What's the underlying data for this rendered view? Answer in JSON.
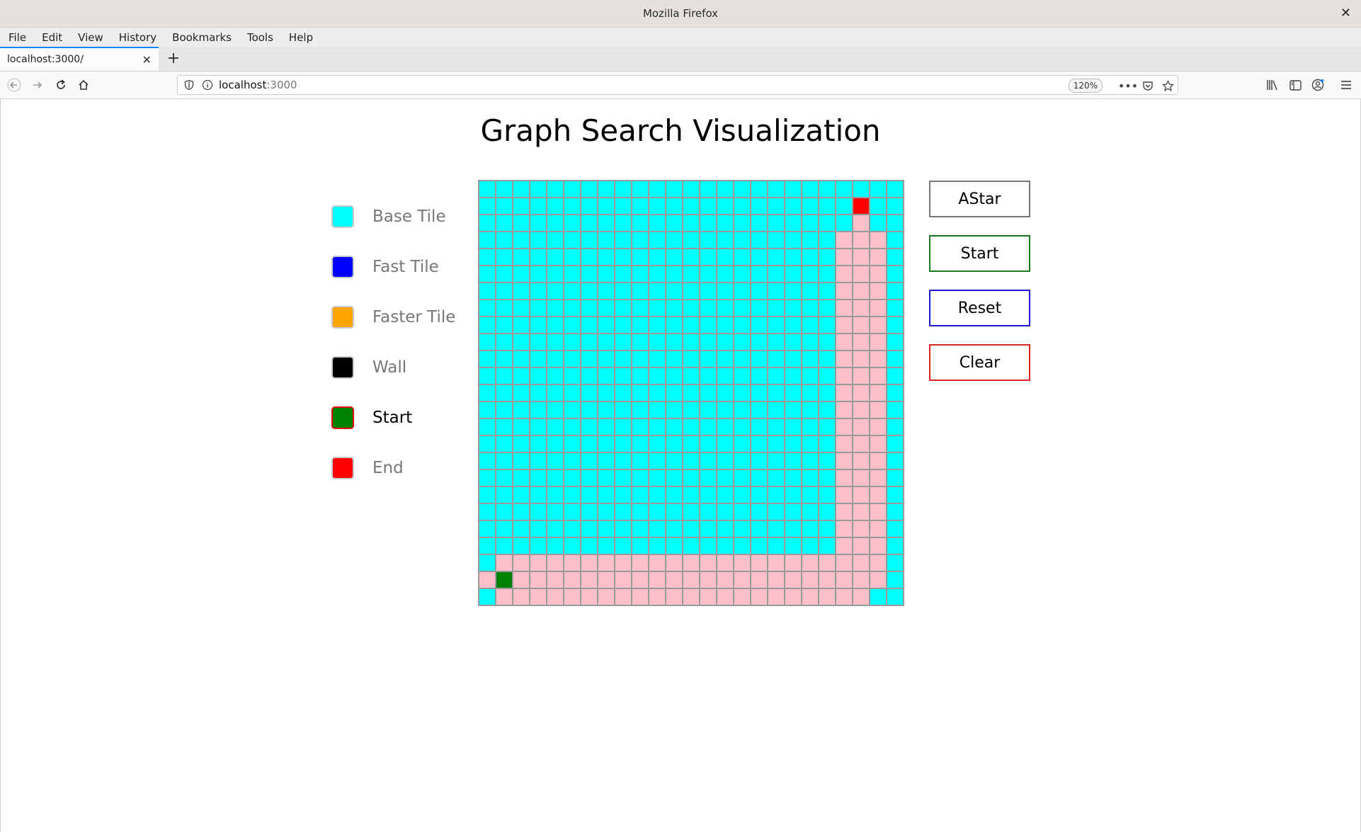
{
  "window": {
    "title": "Mozilla Firefox"
  },
  "menu": [
    "File",
    "Edit",
    "View",
    "History",
    "Bookmarks",
    "Tools",
    "Help"
  ],
  "tab": {
    "title": "localhost:3000/"
  },
  "url": {
    "host": "localhost",
    "port": ":3000",
    "zoom": "120%"
  },
  "page": {
    "title": "Graph Search Visualization"
  },
  "legend": [
    {
      "label": "Base Tile",
      "color": "#00ffff",
      "border": "#c9c9c9",
      "active": false
    },
    {
      "label": "Fast Tile",
      "color": "#0000ff",
      "border": "#c9c9c9",
      "active": false
    },
    {
      "label": "Faster Tile",
      "color": "#ffa500",
      "border": "#c9c9c9",
      "active": false
    },
    {
      "label": "Wall",
      "color": "#000000",
      "border": "#c9c9c9",
      "active": false
    },
    {
      "label": "Start",
      "color": "#008000",
      "border": "#e01010",
      "active": true
    },
    {
      "label": "End",
      "color": "#ff0000",
      "border": "#c9c9c9",
      "active": false
    }
  ],
  "buttons": {
    "astar": "AStar",
    "start": "Start",
    "reset": "Reset",
    "clear": "Clear"
  },
  "grid": {
    "rows": 25,
    "cols": 25,
    "colors": {
      "base": "#00ffff",
      "path": "#ffc0cb",
      "start": "#008000",
      "end": "#ff0000"
    },
    "start": [
      23,
      1
    ],
    "end": [
      1,
      22
    ],
    "path_cells": [
      [
        2,
        22
      ],
      [
        3,
        21
      ],
      [
        3,
        22
      ],
      [
        3,
        23
      ],
      [
        4,
        21
      ],
      [
        4,
        22
      ],
      [
        4,
        23
      ],
      [
        5,
        21
      ],
      [
        5,
        22
      ],
      [
        5,
        23
      ],
      [
        6,
        21
      ],
      [
        6,
        22
      ],
      [
        6,
        23
      ],
      [
        7,
        21
      ],
      [
        7,
        22
      ],
      [
        7,
        23
      ],
      [
        8,
        21
      ],
      [
        8,
        22
      ],
      [
        8,
        23
      ],
      [
        9,
        21
      ],
      [
        9,
        22
      ],
      [
        9,
        23
      ],
      [
        10,
        21
      ],
      [
        10,
        22
      ],
      [
        10,
        23
      ],
      [
        11,
        21
      ],
      [
        11,
        22
      ],
      [
        11,
        23
      ],
      [
        12,
        21
      ],
      [
        12,
        22
      ],
      [
        12,
        23
      ],
      [
        13,
        21
      ],
      [
        13,
        22
      ],
      [
        13,
        23
      ],
      [
        14,
        21
      ],
      [
        14,
        22
      ],
      [
        14,
        23
      ],
      [
        15,
        21
      ],
      [
        15,
        22
      ],
      [
        15,
        23
      ],
      [
        16,
        21
      ],
      [
        16,
        22
      ],
      [
        16,
        23
      ],
      [
        17,
        21
      ],
      [
        17,
        22
      ],
      [
        17,
        23
      ],
      [
        18,
        21
      ],
      [
        18,
        22
      ],
      [
        18,
        23
      ],
      [
        19,
        21
      ],
      [
        19,
        22
      ],
      [
        19,
        23
      ],
      [
        20,
        21
      ],
      [
        20,
        22
      ],
      [
        20,
        23
      ],
      [
        21,
        21
      ],
      [
        21,
        22
      ],
      [
        21,
        23
      ],
      [
        22,
        1
      ],
      [
        22,
        2
      ],
      [
        22,
        3
      ],
      [
        22,
        4
      ],
      [
        22,
        5
      ],
      [
        22,
        6
      ],
      [
        22,
        7
      ],
      [
        22,
        8
      ],
      [
        22,
        9
      ],
      [
        22,
        10
      ],
      [
        22,
        11
      ],
      [
        22,
        12
      ],
      [
        22,
        13
      ],
      [
        22,
        14
      ],
      [
        22,
        15
      ],
      [
        22,
        16
      ],
      [
        22,
        17
      ],
      [
        22,
        18
      ],
      [
        22,
        19
      ],
      [
        22,
        20
      ],
      [
        22,
        21
      ],
      [
        22,
        22
      ],
      [
        22,
        23
      ],
      [
        23,
        0
      ],
      [
        23,
        2
      ],
      [
        23,
        3
      ],
      [
        23,
        4
      ],
      [
        23,
        5
      ],
      [
        23,
        6
      ],
      [
        23,
        7
      ],
      [
        23,
        8
      ],
      [
        23,
        9
      ],
      [
        23,
        10
      ],
      [
        23,
        11
      ],
      [
        23,
        12
      ],
      [
        23,
        13
      ],
      [
        23,
        14
      ],
      [
        23,
        15
      ],
      [
        23,
        16
      ],
      [
        23,
        17
      ],
      [
        23,
        18
      ],
      [
        23,
        19
      ],
      [
        23,
        20
      ],
      [
        23,
        21
      ],
      [
        23,
        22
      ],
      [
        23,
        23
      ],
      [
        24,
        1
      ],
      [
        24,
        2
      ],
      [
        24,
        3
      ],
      [
        24,
        4
      ],
      [
        24,
        5
      ],
      [
        24,
        6
      ],
      [
        24,
        7
      ],
      [
        24,
        8
      ],
      [
        24,
        9
      ],
      [
        24,
        10
      ],
      [
        24,
        11
      ],
      [
        24,
        12
      ],
      [
        24,
        13
      ],
      [
        24,
        14
      ],
      [
        24,
        15
      ],
      [
        24,
        16
      ],
      [
        24,
        17
      ],
      [
        24,
        18
      ],
      [
        24,
        19
      ],
      [
        24,
        20
      ],
      [
        24,
        21
      ],
      [
        24,
        22
      ]
    ]
  }
}
